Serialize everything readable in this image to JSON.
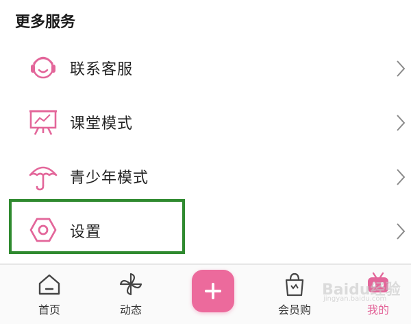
{
  "section": {
    "title": "更多服务"
  },
  "menu": {
    "items": [
      {
        "label": "联系客服",
        "icon": "headset-icon"
      },
      {
        "label": "课堂模式",
        "icon": "classroom-icon"
      },
      {
        "label": "青少年模式",
        "icon": "umbrella-icon"
      },
      {
        "label": "设置",
        "icon": "settings-hexagon-icon"
      }
    ]
  },
  "tabbar": {
    "tabs": [
      {
        "label": "首页",
        "icon": "home-icon"
      },
      {
        "label": "动态",
        "icon": "pinwheel-icon"
      },
      {
        "label": "会员购",
        "icon": "shopping-bag-icon"
      },
      {
        "label": "我的",
        "icon": "tv-mascot-icon",
        "active": true
      }
    ],
    "plus_icon": "plus-icon"
  },
  "watermark": {
    "text": "Baidu经验",
    "sub": "jingyan.baidu.com"
  },
  "colors": {
    "accent": "#e3669a",
    "highlight": "#2f8a2f",
    "plus_button": "#ec6a9c"
  }
}
